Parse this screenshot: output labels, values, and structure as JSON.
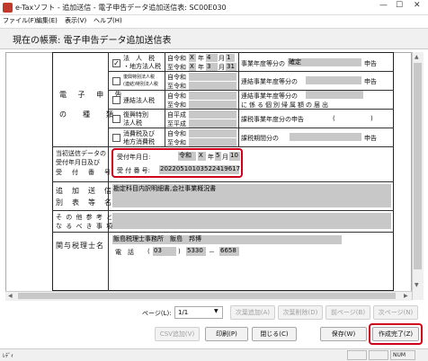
{
  "window": {
    "title": "e-Taxソフト - 追加送信 - 電子申告データ追加送信表: SC00E030",
    "min": "—",
    "max": "☐",
    "close": "✕"
  },
  "menu": [
    "ファイル(F)",
    "編集(E)",
    "表示(V)",
    "ヘルプ(H)"
  ],
  "current_form": {
    "label": "現在の帳票: 電子申告データ追加送信表"
  },
  "form": {
    "section_title_1": "電 子 申 告",
    "section_title_2": "の　種　類",
    "rows": [
      {
        "checked": true,
        "label1": "法　人　税",
        "label2": "・地方法人税",
        "era1": "自令和",
        "era2": "至令和",
        "y1": "X",
        "m1": "4",
        "d1": "1",
        "y2": "X",
        "m2": "3",
        "d2": "31",
        "desc_pre": "事業年度等分の",
        "desc_value": "確定",
        "desc_post": "申告"
      },
      {
        "checked": false,
        "label1": "復興特別法人税",
        "label2": "(連結)特別法人税",
        "era1": "自令和",
        "era2": "至令和",
        "desc_pre": "連結事業年度等分の",
        "desc_post": "申告"
      },
      {
        "checked": false,
        "label1": "連結法人税",
        "era1": "自令和",
        "era2": "至令和",
        "desc_pre": "連結事業年度等分の",
        "desc_line2": "に係る個別帰属額の届出"
      },
      {
        "checked": false,
        "label1": "復興特別",
        "label2": "法人税",
        "era1": "自平成",
        "era2": "至平成",
        "desc_pre": "課税事業年度分の申告",
        "desc_paren_open": "(",
        "desc_paren_close": ")"
      },
      {
        "checked": false,
        "label1": "消費税及び",
        "label2": "地方消費税",
        "era1": "自令和",
        "era2": "至令和",
        "desc_pre": "課税期間分の",
        "desc_post": "申告"
      }
    ],
    "date_unit_y": "年",
    "date_unit_m": "月",
    "date_unit_d": "日",
    "receipt_label_1": "当初送信データの",
    "receipt_label_2": "受付年月日及び",
    "receipt_label_3": "受　付　番　号",
    "receipt_date_label": "受付年月日:",
    "receipt_era": "令和",
    "receipt_year": "X",
    "receipt_month": "5",
    "receipt_day": "10",
    "receipt_no_label": "受 付 番 号:",
    "receipt_no": "20220510103522419617",
    "additional_label_1": "追　加　送　信",
    "additional_label_2": "別　表　等　名",
    "additional_value": "勘定科目内訳明細書,会社事業概況書",
    "other_label_1": "そ の 他 参 考 と",
    "other_label_2": "な る べ き 事 項",
    "tax_label": "関与税理士名",
    "tax_name": "飯島税理士事務所　飯島　邦博",
    "tel_label": "電　話",
    "tel_open": "(",
    "tel_area": "03",
    "tel_close": ")",
    "tel_mid": "5330",
    "tel_dash": "－",
    "tel_last": "6658"
  },
  "pager": {
    "label": "ページ(L):",
    "value": "1/1"
  },
  "buttons": {
    "next_add": "次葉追加(A)",
    "next_del": "次葉削除(D)",
    "prev_page": "前ページ(B)",
    "next_page": "次ページ(N)",
    "csv_add": "CSV追加(V)",
    "print": "印刷(P)",
    "close": "閉じる(C)",
    "save": "保存(W)",
    "finish": "作成完了(Z)"
  },
  "status": {
    "left": "ﾚﾃﾞｨ",
    "num": "NUM"
  },
  "colors": {
    "highlight": "#d0021b",
    "field": "#c8c8c8"
  }
}
